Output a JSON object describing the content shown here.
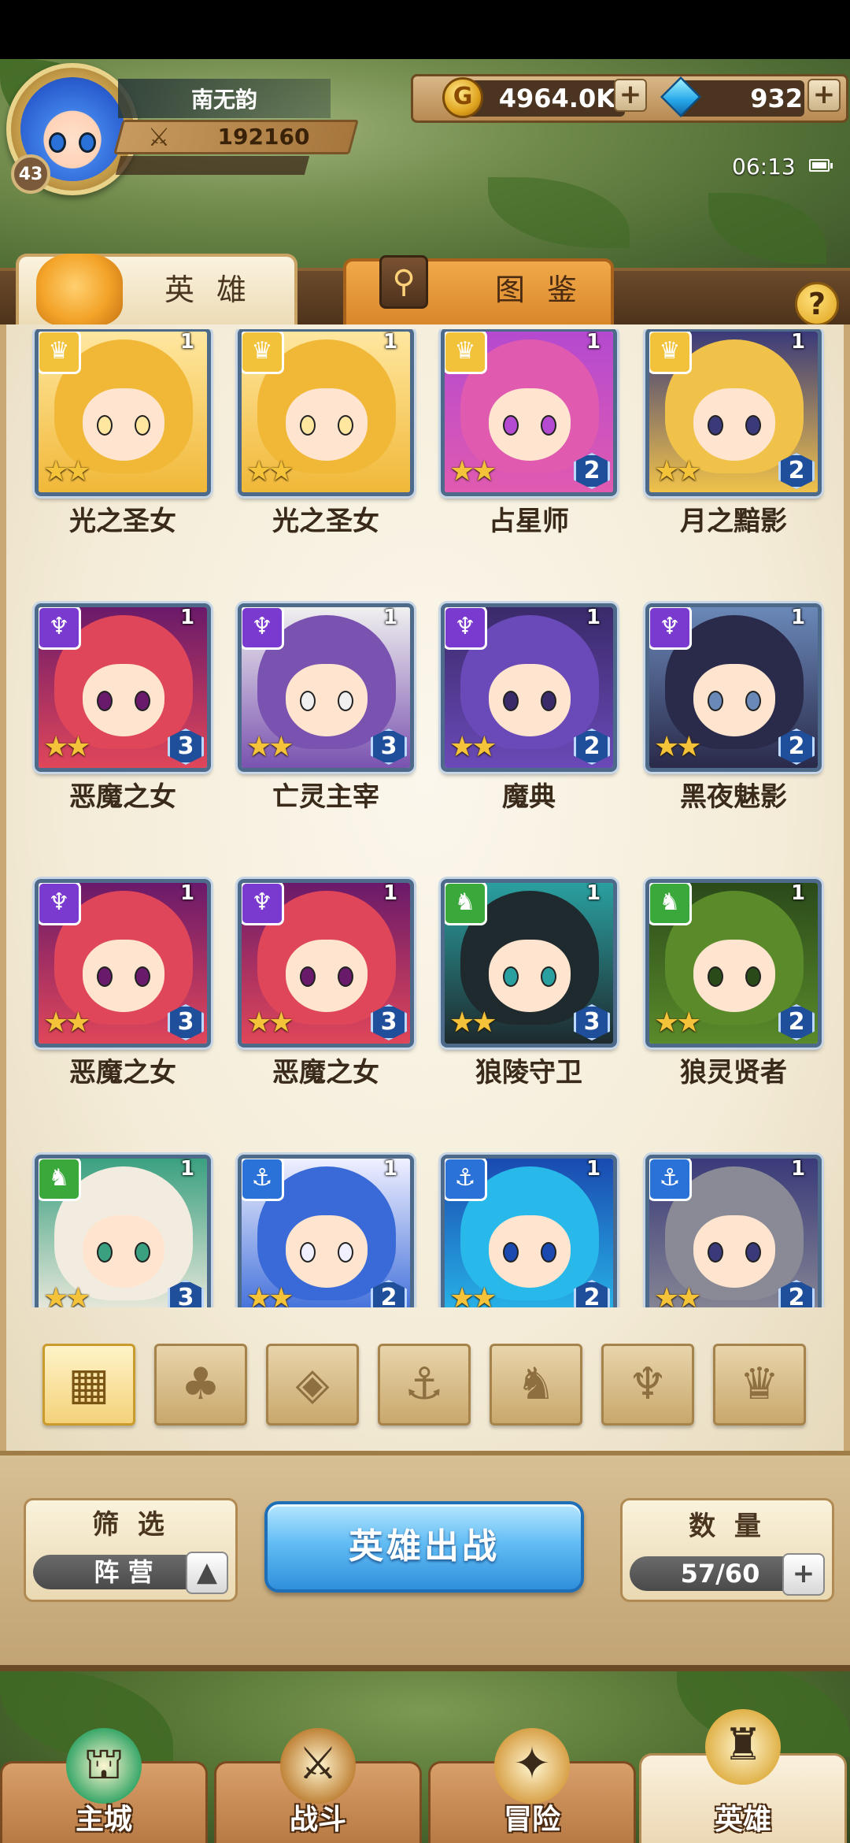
{
  "player": {
    "name": "南无韵",
    "level": "43",
    "power": "192160"
  },
  "resources": {
    "gold": "4964.0K",
    "gems": "932",
    "plus": "+"
  },
  "status": {
    "time": "06:13"
  },
  "tabs": [
    {
      "label": "英 雄",
      "active": true
    },
    {
      "label": "图 鉴",
      "active": false
    }
  ],
  "help_label": "?",
  "heroes": [
    {
      "name": "光之圣女",
      "faction": "light",
      "level": "1",
      "stars": 2,
      "grade": "",
      "colors": [
        "#f1b838",
        "#ffe7a0"
      ]
    },
    {
      "name": "光之圣女",
      "faction": "light",
      "level": "1",
      "stars": 2,
      "grade": "",
      "colors": [
        "#f1b838",
        "#ffe7a0"
      ]
    },
    {
      "name": "占星师",
      "faction": "light",
      "level": "1",
      "stars": 2,
      "grade": "2",
      "colors": [
        "#e05ab0",
        "#b44ad0"
      ]
    },
    {
      "name": "月之黯影",
      "faction": "light",
      "level": "1",
      "stars": 2,
      "grade": "2",
      "colors": [
        "#f0c24a",
        "#3a3a7a"
      ]
    },
    {
      "name": "恶魔之女",
      "faction": "dark",
      "level": "1",
      "stars": 2,
      "grade": "3",
      "colors": [
        "#e0465a",
        "#6a1a6a"
      ]
    },
    {
      "name": "亡灵主宰",
      "faction": "dark",
      "level": "1",
      "stars": 2,
      "grade": "3",
      "colors": [
        "#7a52b0",
        "#f0f0f0"
      ]
    },
    {
      "name": "魔典",
      "faction": "dark",
      "level": "1",
      "stars": 2,
      "grade": "2",
      "colors": [
        "#6a4ab8",
        "#3a2a6a"
      ]
    },
    {
      "name": "黑夜魅影",
      "faction": "dark",
      "level": "1",
      "stars": 2,
      "grade": "2",
      "colors": [
        "#2a2a4a",
        "#6a88b8"
      ]
    },
    {
      "name": "恶魔之女",
      "faction": "dark",
      "level": "1",
      "stars": 2,
      "grade": "3",
      "colors": [
        "#e0465a",
        "#6a1a6a"
      ]
    },
    {
      "name": "恶魔之女",
      "faction": "dark",
      "level": "1",
      "stars": 2,
      "grade": "3",
      "colors": [
        "#e0465a",
        "#6a1a6a"
      ]
    },
    {
      "name": "狼陵守卫",
      "faction": "beast",
      "level": "1",
      "stars": 2,
      "grade": "3",
      "colors": [
        "#1e2a2e",
        "#2aa0a0"
      ]
    },
    {
      "name": "狼灵贤者",
      "faction": "beast",
      "level": "1",
      "stars": 2,
      "grade": "2",
      "colors": [
        "#5a8a2a",
        "#2a4a1a"
      ]
    },
    {
      "name": "",
      "faction": "beast",
      "level": "1",
      "stars": 2,
      "grade": "3",
      "colors": [
        "#f2ece0",
        "#3aa080"
      ]
    },
    {
      "name": "",
      "faction": "sea",
      "level": "1",
      "stars": 2,
      "grade": "2",
      "colors": [
        "#3a6ad8",
        "#f0f0ff"
      ]
    },
    {
      "name": "",
      "faction": "sea",
      "level": "1",
      "stars": 2,
      "grade": "2",
      "colors": [
        "#28b8ea",
        "#1a4ab0"
      ]
    },
    {
      "name": "",
      "faction": "sea",
      "level": "1",
      "stars": 2,
      "grade": "2",
      "colors": [
        "#8a8a96",
        "#3a3a7a"
      ]
    }
  ],
  "faction_colors": {
    "light": "#f2c23a",
    "dark": "#7a3ad0",
    "beast": "#3aa83a",
    "sea": "#2a72d8"
  },
  "faction_icons": {
    "light": "crown-icon",
    "dark": "horned-demon-icon",
    "beast": "wolf-head-icon",
    "sea": "anchor-icon"
  },
  "filters": [
    {
      "icon": "all-grid-icon",
      "glyph": "▦",
      "active": true
    },
    {
      "icon": "leaf-icon",
      "glyph": "♣",
      "active": false
    },
    {
      "icon": "diamond-icon",
      "glyph": "◈",
      "active": false
    },
    {
      "icon": "anchor-icon",
      "glyph": "⚓",
      "active": false
    },
    {
      "icon": "wolf-head-icon",
      "glyph": "♞",
      "active": false
    },
    {
      "icon": "horned-demon-icon",
      "glyph": "♆",
      "active": false
    },
    {
      "icon": "crown-icon",
      "glyph": "♛",
      "active": false
    }
  ],
  "controls": {
    "filter_title": "筛 选",
    "filter_value": "阵 营",
    "deploy_label": "英雄出战",
    "count_title": "数 量",
    "count_value": "57/60"
  },
  "nav": [
    {
      "label": "主城",
      "icon": "castle-icon",
      "glyph": "⛫",
      "active": false
    },
    {
      "label": "战斗",
      "icon": "crossed-swords-icon",
      "glyph": "⚔",
      "active": false
    },
    {
      "label": "冒险",
      "icon": "scroll-map-icon",
      "glyph": "✦",
      "active": false
    },
    {
      "label": "英雄",
      "icon": "helmet-icon",
      "glyph": "♜",
      "active": true
    }
  ]
}
